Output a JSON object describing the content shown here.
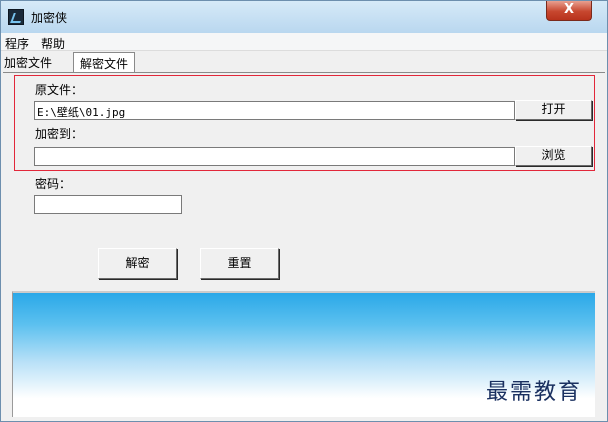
{
  "window": {
    "title": "加密侠",
    "close_label": "X"
  },
  "menu": {
    "items": [
      "程序",
      "帮助"
    ]
  },
  "tabs": [
    {
      "label": "加密文件"
    },
    {
      "label": "解密文件"
    }
  ],
  "source": {
    "label": "原文件：",
    "value": "E:\\壁纸\\01.jpg",
    "button": "打开"
  },
  "destination": {
    "label": "加密到：",
    "value": "",
    "button": "浏览"
  },
  "password": {
    "label": "密码：",
    "value": ""
  },
  "actions": {
    "decrypt": "解密",
    "reset": "重置"
  },
  "watermark": "最需教育"
}
